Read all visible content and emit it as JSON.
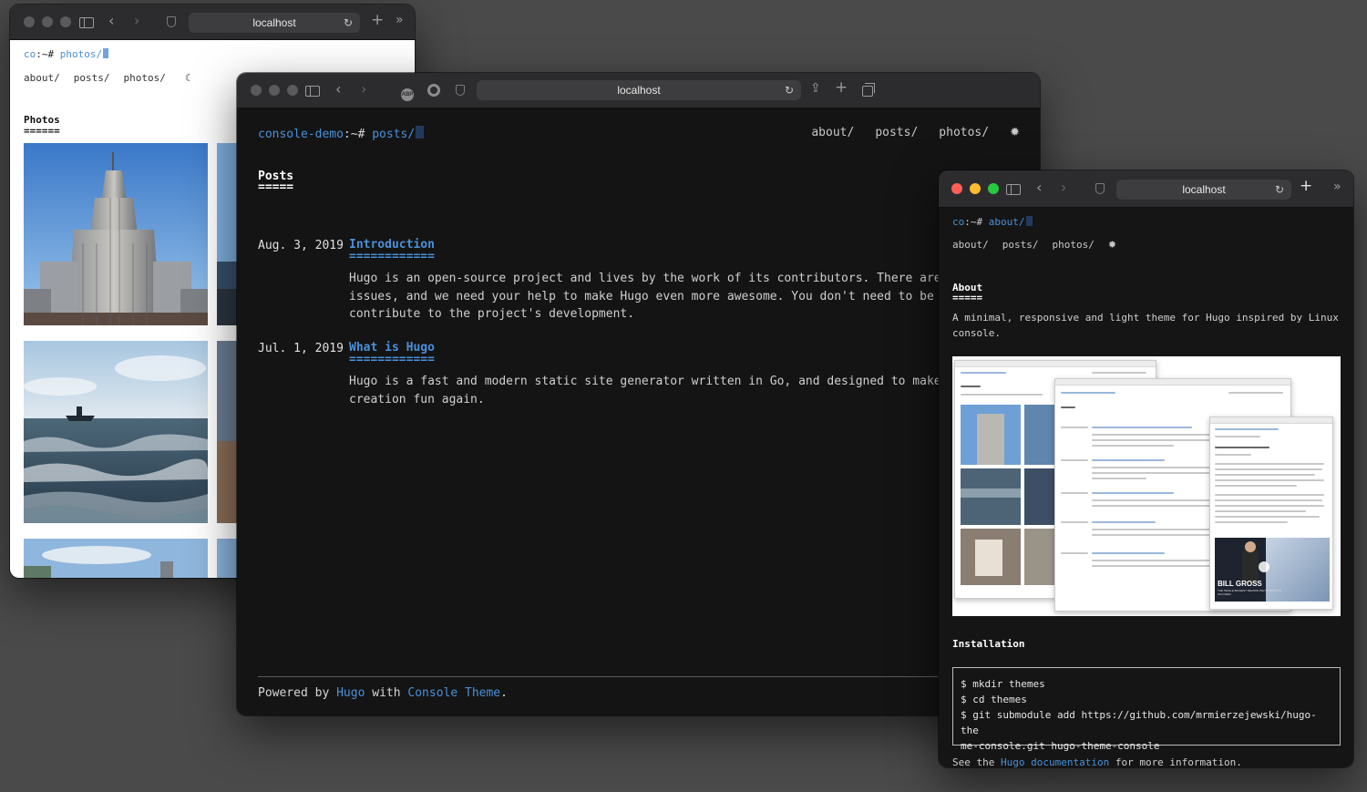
{
  "photos_window": {
    "url": "localhost",
    "prompt_user": "co",
    "prompt_sep": ":~#",
    "prompt_path": "photos/",
    "nav": [
      "about/",
      "posts/",
      "photos/"
    ],
    "heading": "Photos",
    "heading_underline": "======"
  },
  "posts_window": {
    "url": "localhost",
    "prompt_user": "console-demo",
    "prompt_sep": ":~#",
    "prompt_path": "posts/",
    "nav": [
      "about/",
      "posts/",
      "photos/"
    ],
    "heading": "Posts",
    "heading_underline": "=====",
    "posts": [
      {
        "date": "Aug. 3, 2019",
        "title": "Introduction",
        "underline": "============",
        "summary": [
          "Hugo is an open-source project and lives by the work of its contributors. There are ple",
          "issues, and we need your help to make Hugo even more awesome. You don't need to be a Go",
          "contribute to the project's development."
        ]
      },
      {
        "date": "Jul. 1, 2019",
        "title": "What is Hugo",
        "underline": "============",
        "summary": [
          "Hugo is a fast and modern static site generator written in Go, and designed to make web",
          "creation fun again."
        ]
      }
    ],
    "footer": {
      "powered_by": "Powered by",
      "hugo": "Hugo",
      "with": "with",
      "theme": "Console Theme",
      "period": "."
    }
  },
  "about_window": {
    "url": "localhost",
    "prompt_user": "co",
    "prompt_sep": ":~#",
    "prompt_path": "about/",
    "nav": [
      "about/",
      "posts/",
      "photos/"
    ],
    "heading": "About",
    "heading_underline": "=====",
    "description": "A minimal, responsive and light theme for Hugo inspired by Linux console.",
    "installation_heading": "Installation",
    "code_lines": [
      "$ mkdir themes",
      "$ cd themes",
      "$ git submodule add https://github.com/mrmierzejewski/hugo-the",
      "me-console.git hugo-theme-console"
    ],
    "see_the": "See the",
    "docs_link": "Hugo documentation",
    "more_info": "for more information.",
    "preview_overlay": {
      "name": "BILL GROSS",
      "sub": "THE SINGLE BIGGEST REASON WHY STARTUPS SUCCEED"
    }
  },
  "colors": {
    "link": "#4a90d9",
    "dark_bg": "#141414",
    "chrome": "#2c2c2e",
    "desktop": "#4a4a4a"
  },
  "icons": {
    "sidebar": "sidebar-icon",
    "back": "chevron-left-icon",
    "forward": "chevron-right-icon",
    "shield": "shield-icon",
    "reload": "reload-icon",
    "new_tab": "plus-icon",
    "overflow": "chevrons-right-icon",
    "share": "share-icon",
    "tabs": "tab-overview-icon",
    "theme_moon": "moon-icon",
    "theme_gear": "gear-icon"
  }
}
